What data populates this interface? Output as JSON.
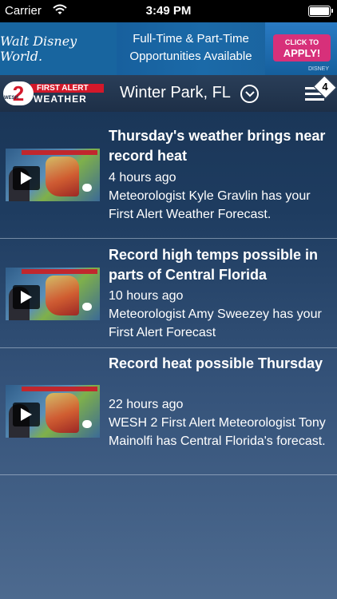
{
  "status_bar": {
    "carrier": "Carrier",
    "time": "3:49 PM"
  },
  "ad": {
    "brand": "Walt Disney World.",
    "line1": "Full-Time & Part-Time",
    "line2": "Opportunities Available",
    "cta_small": "CLICK TO",
    "cta_big": "APPLY!",
    "footer": "DISNEY"
  },
  "header": {
    "brand_number": "2",
    "brand_station": "WESH",
    "brand_line1": "FIRST ALERT",
    "brand_line2": "WEATHER",
    "location": "Winter Park, FL",
    "notification_count": "4"
  },
  "news": [
    {
      "title": "Thursday's weather brings near record heat",
      "time": "4 hours ago",
      "desc": "Meteorologist Kyle Gravlin has your First Alert Weather Forecast."
    },
    {
      "title": "Record high temps possible in parts of Central Florida",
      "time": "10 hours ago",
      "desc": "Meteorologist Amy Sweezey has your First Alert Forecast"
    },
    {
      "title": "Record heat possible Thursday",
      "time": "22 hours ago",
      "desc": "WESH 2 First Alert Meteorologist Tony Mainolfi has Central Florida's forecast."
    }
  ]
}
